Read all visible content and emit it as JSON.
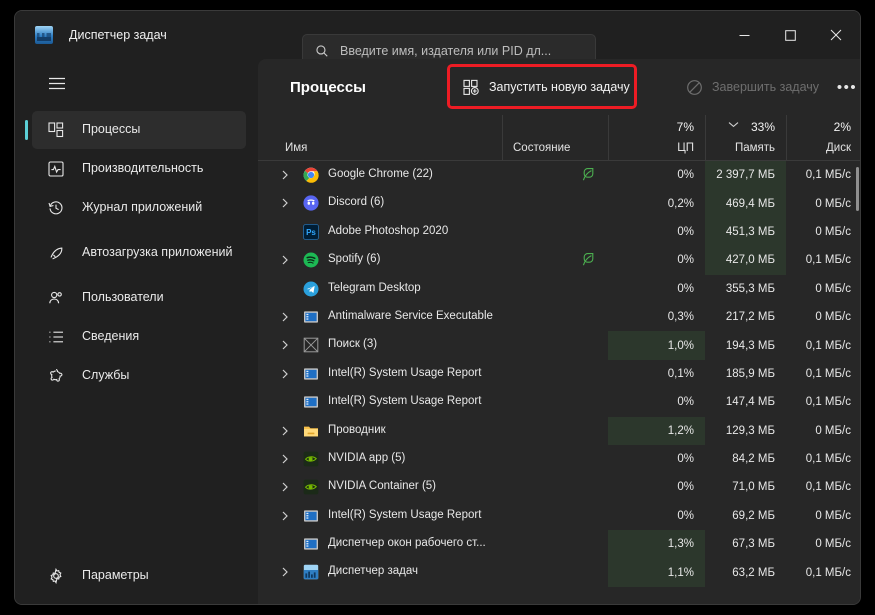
{
  "window": {
    "title": "Диспетчер задач",
    "app_icon": "task-manager-icon",
    "minimize": "—",
    "maximize": "□",
    "close": "✕"
  },
  "search": {
    "placeholder": "Введите имя, издателя или PID дл...",
    "value": "",
    "icon": "search-icon"
  },
  "sidebar": {
    "menu_icon": "hamburger-icon",
    "items": [
      {
        "label": "Процессы",
        "icon": "processes-icon",
        "active": true
      },
      {
        "label": "Производительность",
        "icon": "performance-icon",
        "active": false
      },
      {
        "label": "Журнал приложений",
        "icon": "history-icon",
        "active": false
      },
      {
        "label": "Автозагрузка приложений",
        "icon": "startup-icon",
        "active": false
      },
      {
        "label": "Пользователи",
        "icon": "users-icon",
        "active": false
      },
      {
        "label": "Сведения",
        "icon": "details-icon",
        "active": false
      },
      {
        "label": "Службы",
        "icon": "services-icon",
        "active": false
      }
    ],
    "settings": {
      "label": "Параметры",
      "icon": "gear-icon"
    }
  },
  "toolbar": {
    "page_title": "Процессы",
    "new_task_label": "Запустить новую задачу",
    "new_task_icon": "new-task-icon",
    "end_task_label": "Завершить задачу",
    "end_task_icon": "prohibition-icon",
    "end_task_disabled": true,
    "more_label": "•••"
  },
  "annotation": {
    "color": "#ed1c24",
    "target": "new-task-button"
  },
  "table": {
    "headers": {
      "name": "Имя",
      "status": "Состояние",
      "cpu": "ЦП",
      "memory": "Память",
      "disk": "Диск"
    },
    "totals": {
      "cpu": "7%",
      "memory": "33%",
      "disk": "2%"
    },
    "sorted_column": "memory",
    "sort_direction": "descending",
    "rows": [
      {
        "name": "Google Chrome (22)",
        "icon": "chrome-icon",
        "expandable": true,
        "efficiency": true,
        "cpu": "0%",
        "memory": "2 397,7 МБ",
        "disk": "0,1 МБ/с",
        "cpu_hot": false,
        "mem_hot": true
      },
      {
        "name": "Discord (6)",
        "icon": "discord-icon",
        "expandable": true,
        "efficiency": false,
        "cpu": "0,2%",
        "memory": "469,4 МБ",
        "disk": "0 МБ/с",
        "cpu_hot": false,
        "mem_hot": true
      },
      {
        "name": "Adobe Photoshop 2020",
        "icon": "photoshop-icon",
        "expandable": false,
        "efficiency": false,
        "cpu": "0%",
        "memory": "451,3 МБ",
        "disk": "0 МБ/с",
        "cpu_hot": false,
        "mem_hot": true
      },
      {
        "name": "Spotify (6)",
        "icon": "spotify-icon",
        "expandable": true,
        "efficiency": true,
        "cpu": "0%",
        "memory": "427,0 МБ",
        "disk": "0,1 МБ/с",
        "cpu_hot": false,
        "mem_hot": true
      },
      {
        "name": "Telegram Desktop",
        "icon": "telegram-icon",
        "expandable": false,
        "efficiency": false,
        "cpu": "0%",
        "memory": "355,3 МБ",
        "disk": "0 МБ/с",
        "cpu_hot": false,
        "mem_hot": false
      },
      {
        "name": "Antimalware Service Executable",
        "icon": "window-icon",
        "expandable": true,
        "efficiency": false,
        "cpu": "0,3%",
        "memory": "217,2 МБ",
        "disk": "0 МБ/с",
        "cpu_hot": false,
        "mem_hot": false
      },
      {
        "name": "Поиск (3)",
        "icon": "placeholder-icon",
        "expandable": true,
        "efficiency": false,
        "cpu": "1,0%",
        "memory": "194,3 МБ",
        "disk": "0,1 МБ/с",
        "cpu_hot": true,
        "mem_hot": false
      },
      {
        "name": "Intel(R) System Usage Report",
        "icon": "window-icon",
        "expandable": true,
        "efficiency": false,
        "cpu": "0,1%",
        "memory": "185,9 МБ",
        "disk": "0,1 МБ/с",
        "cpu_hot": false,
        "mem_hot": false
      },
      {
        "name": "Intel(R) System Usage Report",
        "icon": "window-icon",
        "expandable": false,
        "efficiency": false,
        "cpu": "0%",
        "memory": "147,4 МБ",
        "disk": "0,1 МБ/с",
        "cpu_hot": false,
        "mem_hot": false
      },
      {
        "name": "Проводник",
        "icon": "folder-icon",
        "expandable": true,
        "efficiency": false,
        "cpu": "1,2%",
        "memory": "129,3 МБ",
        "disk": "0 МБ/с",
        "cpu_hot": true,
        "mem_hot": false
      },
      {
        "name": "NVIDIA app (5)",
        "icon": "nvidia-icon",
        "expandable": true,
        "efficiency": false,
        "cpu": "0%",
        "memory": "84,2 МБ",
        "disk": "0,1 МБ/с",
        "cpu_hot": false,
        "mem_hot": false
      },
      {
        "name": "NVIDIA Container (5)",
        "icon": "nvidia-icon",
        "expandable": true,
        "efficiency": false,
        "cpu": "0%",
        "memory": "71,0 МБ",
        "disk": "0,1 МБ/с",
        "cpu_hot": false,
        "mem_hot": false
      },
      {
        "name": "Intel(R) System Usage Report",
        "icon": "window-icon",
        "expandable": true,
        "efficiency": false,
        "cpu": "0%",
        "memory": "69,2 МБ",
        "disk": "0 МБ/с",
        "cpu_hot": false,
        "mem_hot": false
      },
      {
        "name": "Диспетчер окон рабочего ст...",
        "icon": "window-icon",
        "expandable": false,
        "efficiency": false,
        "cpu": "1,3%",
        "memory": "67,3 МБ",
        "disk": "0 МБ/с",
        "cpu_hot": true,
        "mem_hot": false
      },
      {
        "name": "Диспетчер задач",
        "icon": "task-manager-icon",
        "expandable": true,
        "efficiency": false,
        "cpu": "1,1%",
        "memory": "63,2 МБ",
        "disk": "0,1 МБ/с",
        "cpu_hot": true,
        "mem_hot": false
      }
    ]
  }
}
